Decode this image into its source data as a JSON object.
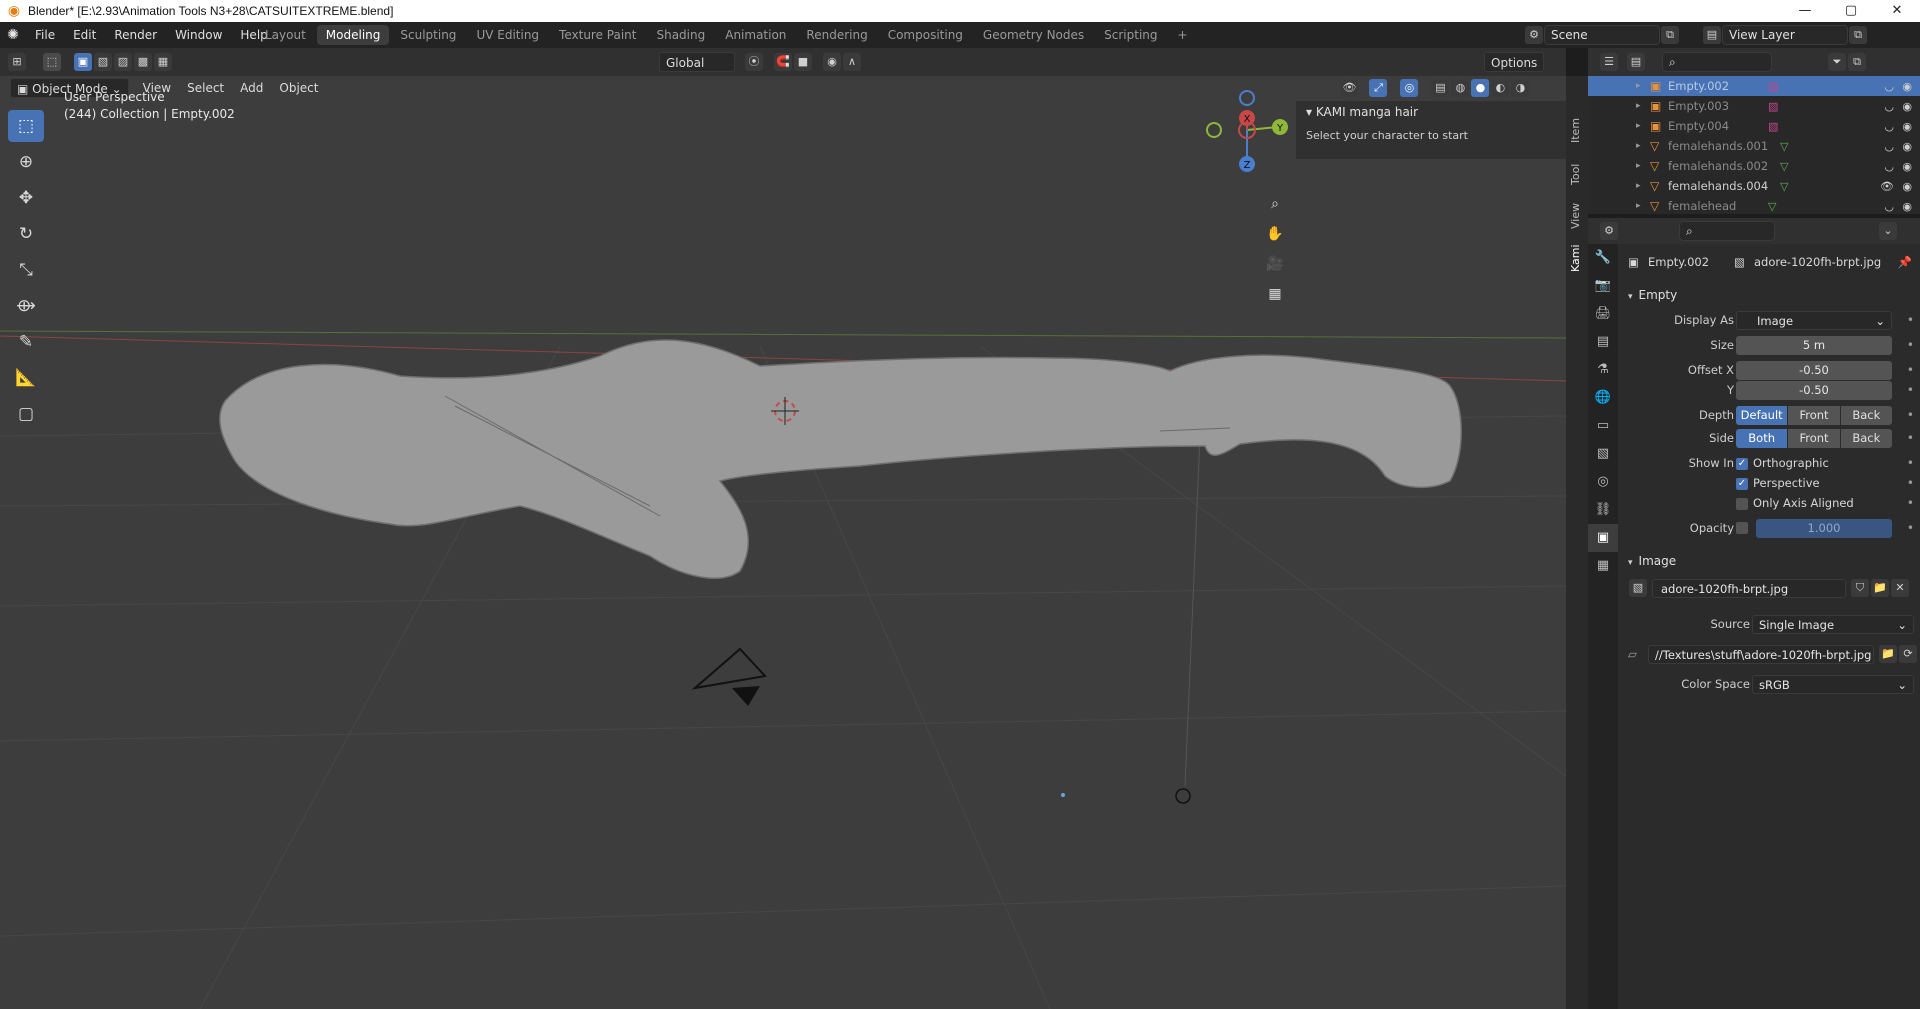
{
  "window": {
    "title": "Blender* [E:\\2.93\\Animation Tools N3+28\\CATSUITEXTREME.blend]",
    "controls": [
      "—",
      "▢",
      "✕"
    ]
  },
  "menu": [
    "File",
    "Edit",
    "Render",
    "Window",
    "Help"
  ],
  "workspaces": [
    "Layout",
    "Modeling",
    "Sculpting",
    "UV Editing",
    "Texture Paint",
    "Shading",
    "Animation",
    "Rendering",
    "Compositing",
    "Geometry Nodes",
    "Scripting",
    "+"
  ],
  "active_workspace": "Modeling",
  "scene": "Scene",
  "view_layer": "View Layer",
  "viewport_header": {
    "transform_orientation": "Global",
    "options": "Options",
    "mode": "Object Mode",
    "menus": [
      "View",
      "Select",
      "Add",
      "Object"
    ]
  },
  "viewport": {
    "perspective": "User Perspective",
    "collection": "(244) Collection | Empty.002",
    "axes": {
      "x": "X",
      "y": "Y",
      "z": "Z"
    }
  },
  "npanel": {
    "title": "KAMI manga hair",
    "body": "Select your character to start",
    "tabs": [
      "Item",
      "Tool",
      "View",
      "Kami"
    ]
  },
  "outliner": {
    "items": [
      {
        "name": "Empty.002",
        "selected": true,
        "dim": true,
        "icon": "empty-icon"
      },
      {
        "name": "Empty.003",
        "selected": false,
        "dim": true,
        "icon": "empty-icon"
      },
      {
        "name": "Empty.004",
        "selected": false,
        "dim": true,
        "icon": "empty-icon"
      },
      {
        "name": "femalehands.001",
        "selected": false,
        "dim": true,
        "icon": "mesh-icon"
      },
      {
        "name": "femalehands.002",
        "selected": false,
        "dim": true,
        "icon": "mesh-icon"
      },
      {
        "name": "femalehands.004",
        "selected": false,
        "dim": false,
        "icon": "mesh-icon"
      },
      {
        "name": "femalehead",
        "selected": false,
        "dim": true,
        "icon": "mesh-icon"
      }
    ]
  },
  "properties": {
    "object_name": "Empty.002",
    "image_name": "adore-1020fh-brpt.jpg",
    "empty_section": "Empty",
    "display_as_label": "Display As",
    "display_as": "Image",
    "size_label": "Size",
    "size": "5 m",
    "offset_x_label": "Offset X",
    "offset_x": "-0.50",
    "offset_y_label": "Y",
    "offset_y": "-0.50",
    "depth_label": "Depth",
    "depth_options": [
      "Default",
      "Front",
      "Back"
    ],
    "depth_selected": "Default",
    "side_label": "Side",
    "side_options": [
      "Both",
      "Front",
      "Back"
    ],
    "side_selected": "Both",
    "show_in_label": "Show In",
    "orthographic": "Orthographic",
    "perspective": "Perspective",
    "only_axis_aligned": "Only Axis Aligned",
    "opacity_label": "Opacity",
    "opacity": "1.000",
    "image_section": "Image",
    "image_datablock": "adore-1020fh-brpt.jpg",
    "source_label": "Source",
    "source": "Single Image",
    "filepath": "//Textures\\stuff\\adore-1020fh-brpt.jpg",
    "color_space_label": "Color Space",
    "color_space": "sRGB"
  },
  "colors": {
    "accent": "#4772b3",
    "viewport_bg": "#3d3d3d",
    "panel_bg": "#2b2b2b"
  }
}
